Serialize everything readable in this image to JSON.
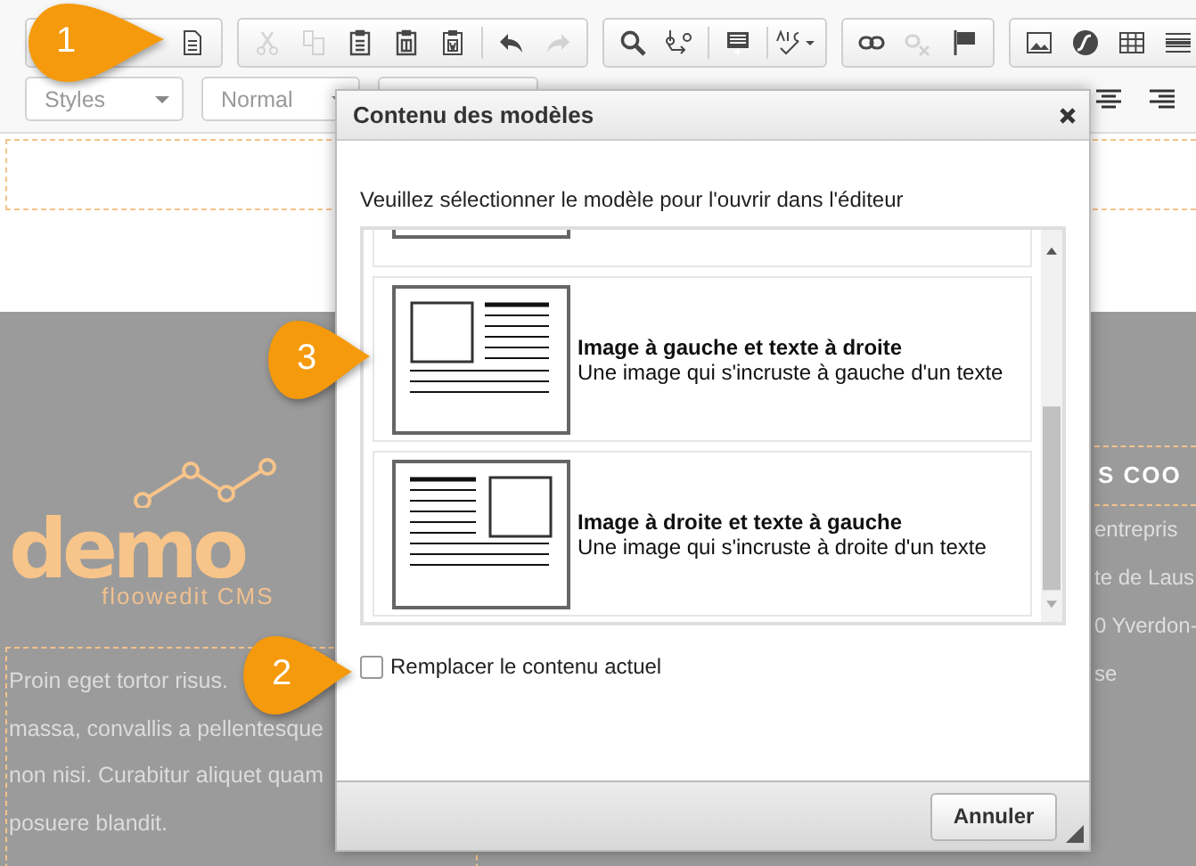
{
  "toolbar": {
    "groups": [
      {
        "buttons": [
          {
            "kind": "templates",
            "disabled": false
          }
        ]
      },
      {
        "buttons": [
          {
            "kind": "cut",
            "disabled": true
          },
          {
            "kind": "copy",
            "disabled": true
          },
          {
            "kind": "paste",
            "disabled": false
          },
          {
            "kind": "paste_text",
            "disabled": false
          },
          {
            "kind": "paste_word",
            "disabled": false
          },
          {
            "kind": "separator"
          },
          {
            "kind": "undo",
            "disabled": false
          },
          {
            "kind": "redo",
            "disabled": true
          }
        ]
      },
      {
        "buttons": [
          {
            "kind": "find",
            "disabled": false
          },
          {
            "kind": "replace",
            "disabled": false
          },
          {
            "kind": "separator"
          },
          {
            "kind": "select_all",
            "disabled": false
          },
          {
            "kind": "separator"
          },
          {
            "kind": "spellcheck",
            "disabled": false
          }
        ]
      },
      {
        "buttons": [
          {
            "kind": "link",
            "disabled": false
          },
          {
            "kind": "unlink",
            "disabled": true
          },
          {
            "kind": "anchor",
            "disabled": false
          }
        ]
      },
      {
        "buttons": [
          {
            "kind": "image",
            "disabled": false
          },
          {
            "kind": "flash",
            "disabled": false
          },
          {
            "kind": "table",
            "disabled": false
          },
          {
            "kind": "hr",
            "disabled": false
          }
        ]
      }
    ],
    "combos": [
      {
        "label": "Styles"
      },
      {
        "label": "Normal"
      }
    ],
    "align_buttons": [
      {
        "kind": "align_center"
      },
      {
        "kind": "align_right"
      }
    ]
  },
  "page": {
    "logo": {
      "word": "demo",
      "tagline": "floowedit CMS"
    },
    "paragraph_lines": [
      "Proin eget tortor risus.",
      "massa, convallis a pellentesque",
      "non nisi. Curabitur aliquet quam",
      "posuere blandit."
    ],
    "right_heading": "S COO",
    "right_lines": [
      "entrepris",
      "te de Laus",
      "0 Yverdon-",
      "se"
    ]
  },
  "dialog": {
    "title": "Contenu des modèles",
    "instruction": "Veuillez sélectionner le modèle pour l'ouvrir dans l'éditeur",
    "templates": [
      {
        "kind": "image_left",
        "title": "Image à gauche et texte à droite",
        "description": "Une image qui s'incruste à gauche d'un texte"
      },
      {
        "kind": "image_right",
        "title": "Image à droite et texte à gauche",
        "description": "Une image qui s'incruste à droite d'un texte"
      }
    ],
    "replace": {
      "label": "Remplacer le contenu actuel",
      "checked": false
    },
    "buttons": [
      "Annuler"
    ]
  },
  "markers": [
    "1",
    "2",
    "3"
  ]
}
